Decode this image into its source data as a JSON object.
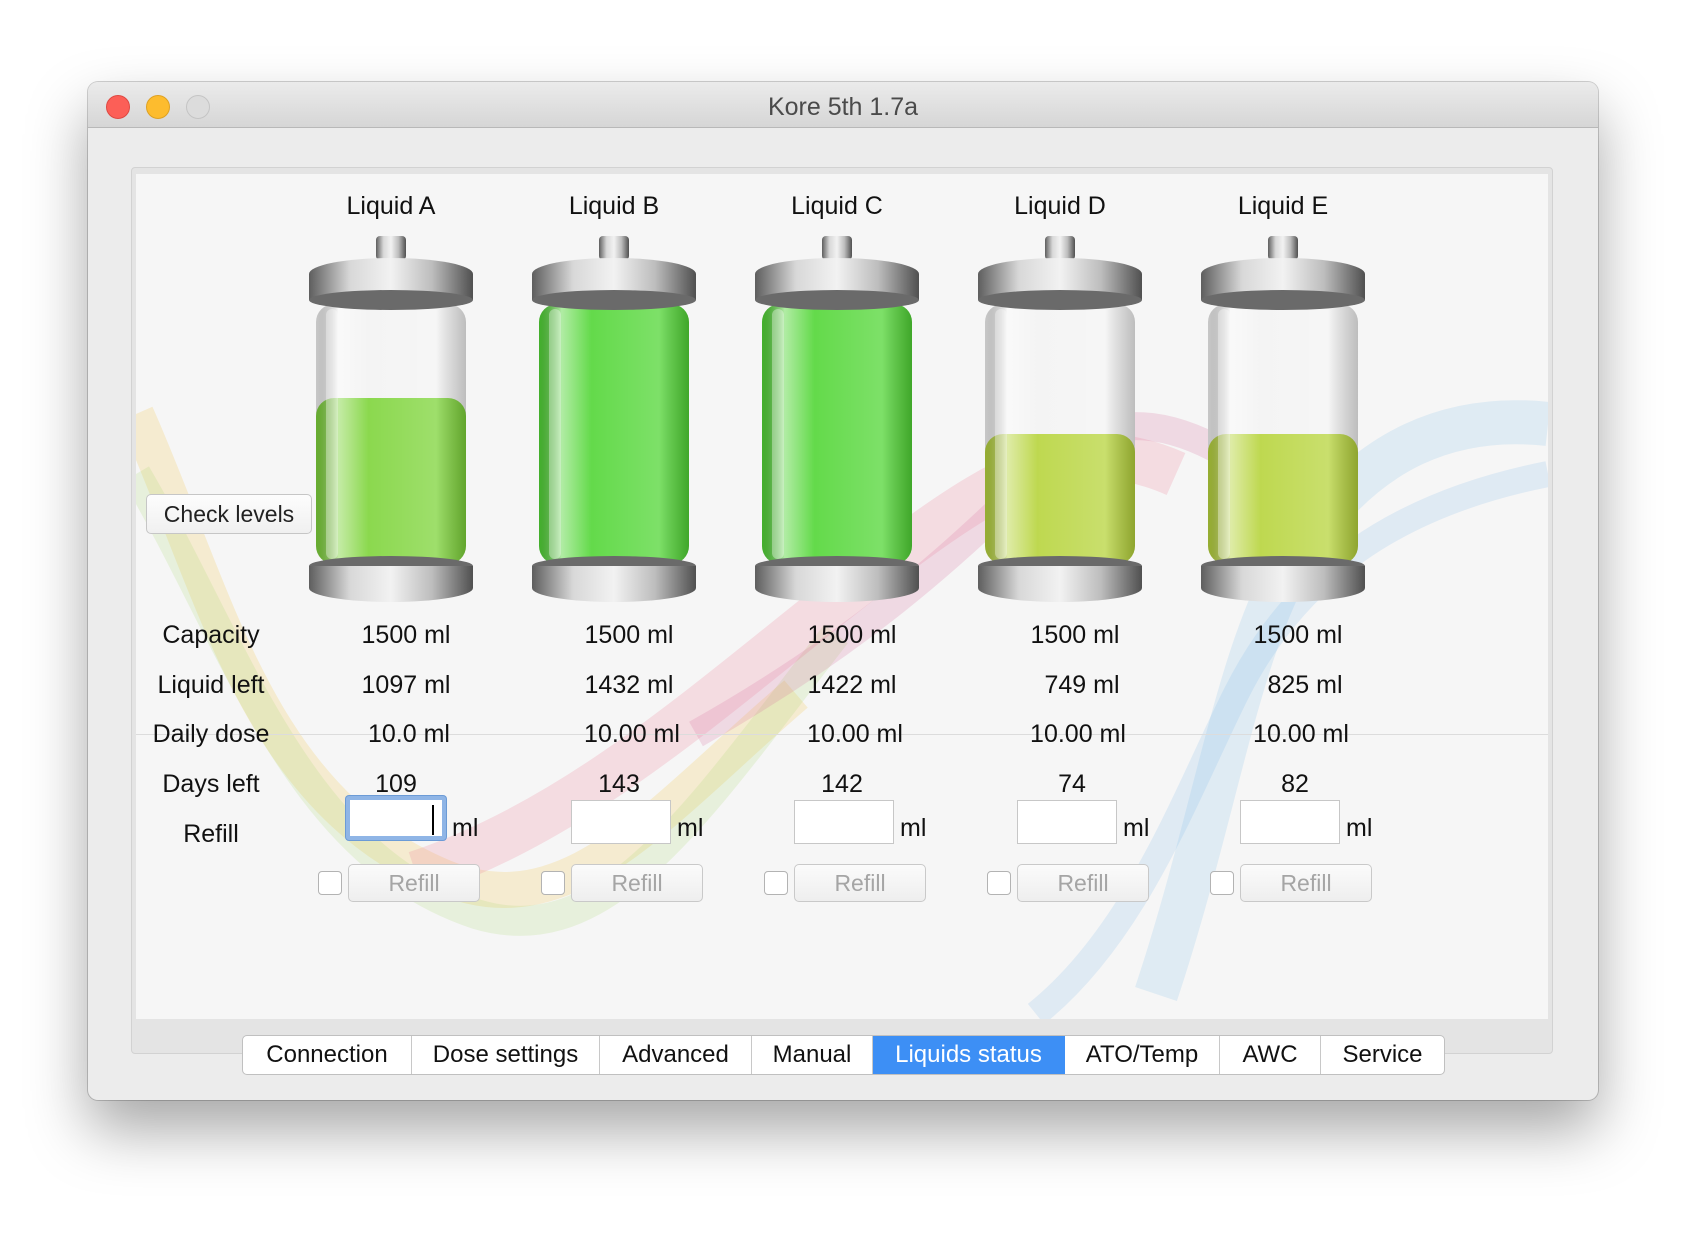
{
  "window": {
    "title": "Kore 5th 1.7a"
  },
  "check_levels_label": "Check levels",
  "row_labels": {
    "capacity": "Capacity",
    "liquid_left": "Liquid left",
    "daily_dose": "Daily dose",
    "days_left": "Days left",
    "refill": "Refill"
  },
  "liquids": [
    {
      "name": "Liquid A",
      "capacity": "1500 ml",
      "left": "1097 ml",
      "daily_dose": "10.0 ml",
      "days_left": "109",
      "refill_value": "",
      "unit": "ml",
      "refill_button": "Refill",
      "fill_fraction": 0.64,
      "fill_color": "#7ed43a"
    },
    {
      "name": "Liquid B",
      "capacity": "1500 ml",
      "left": "1432 ml",
      "daily_dose": "10.00 ml",
      "days_left": "143",
      "refill_value": "",
      "unit": "ml",
      "refill_button": "Refill",
      "fill_fraction": 1.0,
      "fill_color": "#52d636"
    },
    {
      "name": "Liquid C",
      "capacity": "1500 ml",
      "left": "1422 ml",
      "daily_dose": "10.00 ml",
      "days_left": "142",
      "refill_value": "",
      "unit": "ml",
      "refill_button": "Refill",
      "fill_fraction": 1.0,
      "fill_color": "#52d636"
    },
    {
      "name": "Liquid D",
      "capacity": "1500 ml",
      "left": "749 ml",
      "daily_dose": "10.00 ml",
      "days_left": "74",
      "refill_value": "",
      "unit": "ml",
      "refill_button": "Refill",
      "fill_fraction": 0.5,
      "fill_color": "#b7d43c"
    },
    {
      "name": "Liquid E",
      "capacity": "1500 ml",
      "left": "825 ml",
      "daily_dose": "10.00 ml",
      "days_left": "82",
      "refill_value": "",
      "unit": "ml",
      "refill_button": "Refill",
      "fill_fraction": 0.5,
      "fill_color": "#b7d43c"
    }
  ],
  "tabs": [
    {
      "label": "Connection",
      "active": false
    },
    {
      "label": "Dose settings",
      "active": false
    },
    {
      "label": "Advanced",
      "active": false
    },
    {
      "label": "Manual",
      "active": false
    },
    {
      "label": "Liquids status",
      "active": true
    },
    {
      "label": "ATO/Temp",
      "active": false
    },
    {
      "label": "AWC",
      "active": false
    },
    {
      "label": "Service",
      "active": false
    }
  ],
  "colors": {
    "accent": "#3d8ff5",
    "bottle_empty": "#f3f3f3",
    "cap_metal": "#9a9a9a"
  }
}
